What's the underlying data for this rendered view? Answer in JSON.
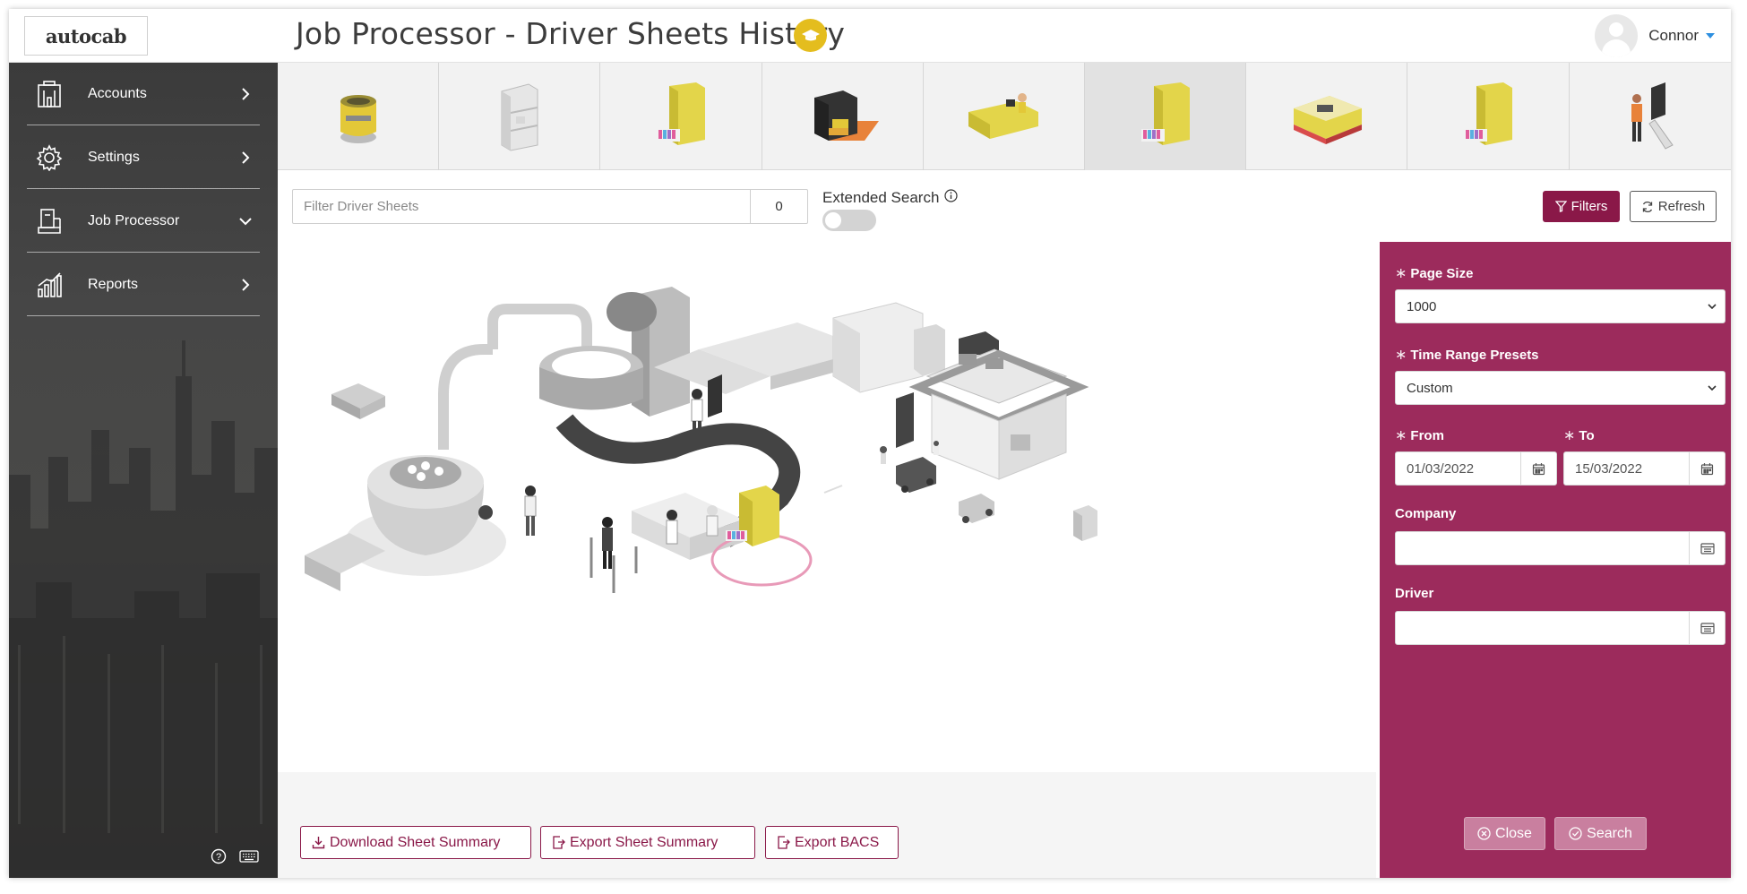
{
  "header": {
    "logo_text": "autocab",
    "title": "Job Processor - Driver Sheets History",
    "user_name": "Connor"
  },
  "sidebar": {
    "items": [
      {
        "label": "Accounts",
        "icon": "building-icon",
        "expanded": false
      },
      {
        "label": "Settings",
        "icon": "gear-icon",
        "expanded": false
      },
      {
        "label": "Job Processor",
        "icon": "processor-icon",
        "expanded": true
      },
      {
        "label": "Reports",
        "icon": "chart-icon",
        "expanded": false
      }
    ]
  },
  "module_tiles": [
    {
      "icon": "yellow-pot-icon"
    },
    {
      "icon": "shelf-icon"
    },
    {
      "icon": "filing-cabinet-icon"
    },
    {
      "icon": "safe-icon"
    },
    {
      "icon": "reception-desk-icon"
    },
    {
      "icon": "filing-cabinet-icon",
      "active": true
    },
    {
      "icon": "office-building-icon"
    },
    {
      "icon": "filing-cabinet-icon"
    },
    {
      "icon": "kiosk-user-icon"
    }
  ],
  "toolbar": {
    "filter_placeholder": "Filter Driver Sheets",
    "filter_count": "0",
    "extended_search_label": "Extended Search",
    "extended_search_on": false,
    "filters_label": "Filters",
    "refresh_label": "Refresh"
  },
  "filters_panel": {
    "page_size_label": "Page Size",
    "page_size_value": "1000",
    "time_range_label": "Time Range Presets",
    "time_range_value": "Custom",
    "from_label": "From",
    "from_value": "01/03/2022",
    "to_label": "To",
    "to_value": "15/03/2022",
    "company_label": "Company",
    "company_value": "",
    "driver_label": "Driver",
    "driver_value": "",
    "close_label": "Close",
    "search_label": "Search"
  },
  "footer": {
    "download_summary_label": "Download Sheet Summary",
    "export_summary_label": "Export Sheet Summary",
    "export_bacs_label": "Export BACS"
  },
  "colors": {
    "accent": "#8a1848",
    "panel": "#9c2b5c",
    "badge": "#e4bd1e",
    "cabinet": "#e3d54a"
  }
}
